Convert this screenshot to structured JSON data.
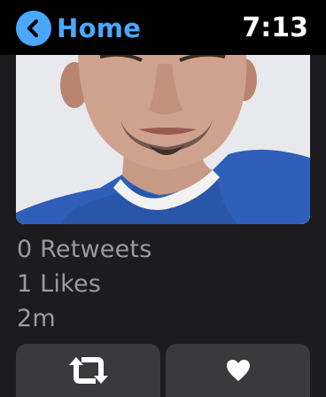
{
  "header": {
    "back_label": "Home",
    "time": "7:13"
  },
  "colors": {
    "accent": "#4aa8ff",
    "card_bg": "#1c1c1e",
    "button_bg": "#3a3a3c",
    "stat_text": "#9b9b9f"
  },
  "tweet": {
    "image_icon": "profile-photo",
    "retweets": "0 Retweets",
    "likes": "1 Likes",
    "age": "2m"
  },
  "actions": {
    "retweet_icon": "retweet-icon",
    "like_icon": "heart-icon"
  }
}
